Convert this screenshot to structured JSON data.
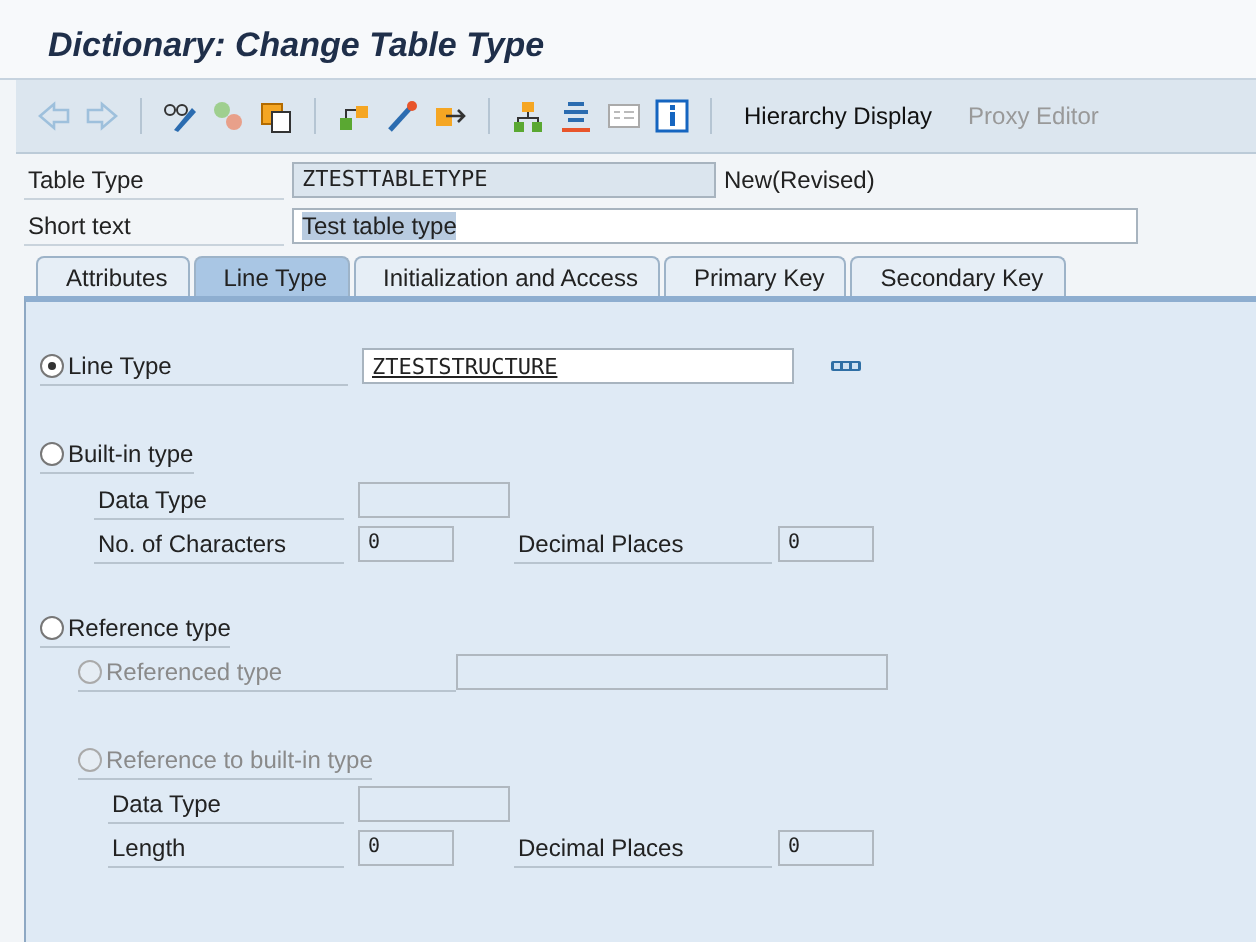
{
  "window": {
    "title": "Dictionary: Change Table Type"
  },
  "toolbar": {
    "buttons": [
      {
        "label": "Hierarchy Display",
        "disabled": false
      },
      {
        "label": "Proxy Editor",
        "disabled": true
      }
    ]
  },
  "header": {
    "table_type": {
      "label": "Table Type",
      "value": "ZTESTTABLETYPE",
      "status": "New(Revised)"
    },
    "short_text": {
      "label": "Short text",
      "value": "Test table type",
      "text_selected": true
    }
  },
  "tabs": [
    {
      "label": "Attributes",
      "selected": false
    },
    {
      "label": "Line Type",
      "selected": true
    },
    {
      "label": "Initialization and Access",
      "selected": false
    },
    {
      "label": "Primary Key",
      "selected": false
    },
    {
      "label": "Secondary Key",
      "selected": false
    }
  ],
  "line_type": {
    "label": "Line Type",
    "selected": true,
    "value": "ZTESTSTRUCTURE"
  },
  "built_in_type": {
    "label": "Built-in type",
    "selected": false,
    "data_type": {
      "label": "Data Type"
    },
    "characters": {
      "label": "No. of Characters",
      "value": "0"
    },
    "decimals": {
      "label": "Decimal Places",
      "value": "0"
    }
  },
  "reference_type": {
    "label": "Reference type",
    "selected": false,
    "referenced_type": {
      "label": "Referenced type",
      "selected": false,
      "disabled": true
    },
    "builtin_reference": {
      "label": "Reference to built-in type",
      "selected": false,
      "disabled": true,
      "data_type": {
        "label": "Data Type"
      },
      "length": {
        "label": "Length",
        "value": "0"
      },
      "decimals": {
        "label": "Decimal Places",
        "value": "0"
      }
    }
  }
}
